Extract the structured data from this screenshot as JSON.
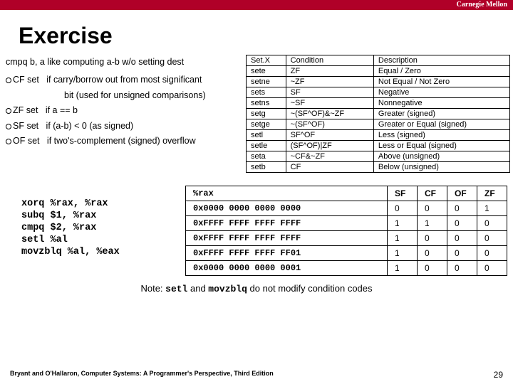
{
  "brand": "Carnegie Mellon",
  "title": "Exercise",
  "intro": "cmpq b, a  like computing a-b w/o setting dest",
  "bullets": {
    "cf1": "CF set   if carry/borrow out from most significant",
    "cf2": "bit (used for unsigned comparisons)",
    "zf": "ZF set   if a == b",
    "sf": "SF set   if (a-b) < 0 (as signed)",
    "of": "OF set   if two's-complement (signed) overflow"
  },
  "setx_head": {
    "c0": "Set.X",
    "c1": "Condition",
    "c2": "Description"
  },
  "setx": [
    {
      "a": "sete",
      "b": "ZF",
      "c": "Equal / Zero"
    },
    {
      "a": "setne",
      "b": "~ZF",
      "c": "Not Equal / Not Zero"
    },
    {
      "a": "sets",
      "b": "SF",
      "c": "Negative"
    },
    {
      "a": "setns",
      "b": "~SF",
      "c": "Nonnegative"
    },
    {
      "a": "setg",
      "b": "~(SF^OF)&~ZF",
      "c": "Greater (signed)"
    },
    {
      "a": "setge",
      "b": "~(SF^OF)",
      "c": "Greater or Equal (signed)"
    },
    {
      "a": "setl",
      "b": "SF^OF",
      "c": "Less (signed)"
    },
    {
      "a": "setle",
      "b": "(SF^OF)|ZF",
      "c": "Less or Equal (signed)"
    },
    {
      "a": "seta",
      "b": "~CF&~ZF",
      "c": "Above (unsigned)"
    },
    {
      "a": "setb",
      "b": "CF",
      "c": "Below (unsigned)"
    }
  ],
  "code": [
    "xorq    %rax, %rax",
    "subq    $1, %rax",
    "cmpq    $2, %rax",
    "setl    %al",
    "movzblq %al, %eax"
  ],
  "flags_head": {
    "val": "%rax",
    "sf": "SF",
    "cf": "CF",
    "of": "OF",
    "zf": "ZF"
  },
  "flags": [
    {
      "val": "0x0000 0000 0000 0000",
      "sf": "0",
      "cf": "0",
      "of": "0",
      "zf": "1"
    },
    {
      "val": "0xFFFF FFFF FFFF FFFF",
      "sf": "1",
      "cf": "1",
      "of": "0",
      "zf": "0"
    },
    {
      "val": "0xFFFF FFFF FFFF FFFF",
      "sf": "1",
      "cf": "0",
      "of": "0",
      "zf": "0"
    },
    {
      "val": "0xFFFF FFFF FFFF FF01",
      "sf": "1",
      "cf": "0",
      "of": "0",
      "zf": "0"
    },
    {
      "val": "0x0000 0000 0000 0001",
      "sf": "1",
      "cf": "0",
      "of": "0",
      "zf": "0"
    }
  ],
  "note": {
    "a": "Note: ",
    "b": "setl",
    "c": " and ",
    "d": "movzblq",
    "e": " do not modify condition codes"
  },
  "footer": {
    "credit": "Bryant and O'Hallaron, Computer Systems: A Programmer's Perspective, Third Edition",
    "page": "29"
  }
}
